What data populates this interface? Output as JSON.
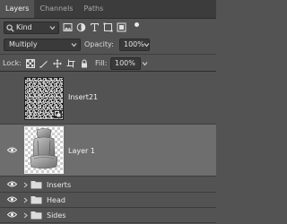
{
  "tabs": [
    {
      "label": "Layers"
    },
    {
      "label": "Channels"
    },
    {
      "label": "Paths"
    }
  ],
  "filter": {
    "kind_label": "Kind",
    "icons": [
      "image-filter-icon",
      "adjustment-filter-icon",
      "type-filter-icon",
      "shape-filter-icon",
      "smart-object-filter-icon"
    ]
  },
  "blend": {
    "mode": "Multiply",
    "opacity_label": "Opacity:",
    "opacity_value": "100%"
  },
  "lock": {
    "label": "Lock:",
    "icons": [
      "lock-transparent-icon",
      "lock-image-icon",
      "lock-position-icon",
      "lock-artboard-icon",
      "lock-all-icon"
    ],
    "fill_label": "Fill:",
    "fill_value": "100%"
  },
  "layers": [
    {
      "name": "Insert21",
      "visible": false,
      "thumbnail": "pattern-smart-object"
    },
    {
      "name": "Layer 1",
      "visible": true,
      "thumbnail": "car-seat",
      "selected": true
    }
  ],
  "groups": [
    {
      "name": "Inserts",
      "visible": true
    },
    {
      "name": "Head",
      "visible": true
    },
    {
      "name": "Sides",
      "visible": true
    }
  ],
  "colors": {
    "panel_bg": "#535353",
    "tab_bar_bg": "#3c3c3c",
    "selected_row": "#6e6e6e",
    "field_bg": "#3a3a3a"
  }
}
